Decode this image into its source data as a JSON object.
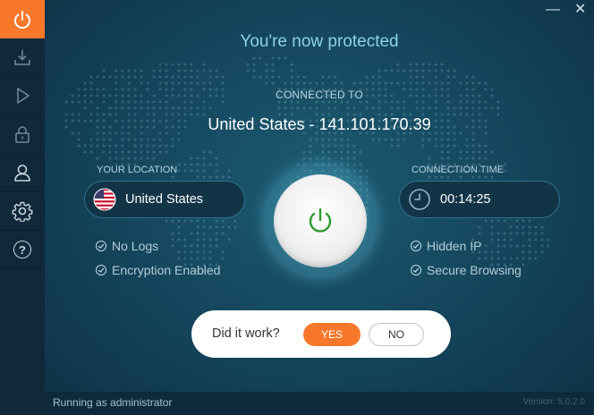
{
  "sidebar": {
    "items": [
      {
        "icon": "power-icon",
        "active": true
      },
      {
        "icon": "download-icon"
      },
      {
        "icon": "play-icon"
      },
      {
        "icon": "lock-icon"
      },
      {
        "icon": "user-icon"
      },
      {
        "icon": "gear-icon"
      },
      {
        "icon": "help-icon",
        "symbol": "?"
      }
    ]
  },
  "window": {
    "minimize_symbol": "—",
    "close_symbol": "✕"
  },
  "header": {
    "title": "You're now protected"
  },
  "connection": {
    "label": "CONNECTED TO",
    "value": "United States - 141.101.170.39"
  },
  "location": {
    "label": "YOUR LOCATION",
    "value": "United States",
    "flag": "us-flag-icon"
  },
  "time": {
    "label": "CONNECTION TIME",
    "value": "00:14:25"
  },
  "features_left": [
    "No Logs",
    "Encryption Enabled"
  ],
  "features_right": [
    "Hidden IP",
    "Secure Browsing"
  ],
  "feedback": {
    "question": "Did it work?",
    "yes_label": "YES",
    "no_label": "NO"
  },
  "status": {
    "left": "Running as administrator",
    "version": "Version: 5.0.2.0"
  },
  "colors": {
    "accent": "#f7782a",
    "background": "#164a61",
    "sidebar": "#10283a",
    "power_green": "#2e9a2e",
    "title": "#8ad3e8"
  }
}
